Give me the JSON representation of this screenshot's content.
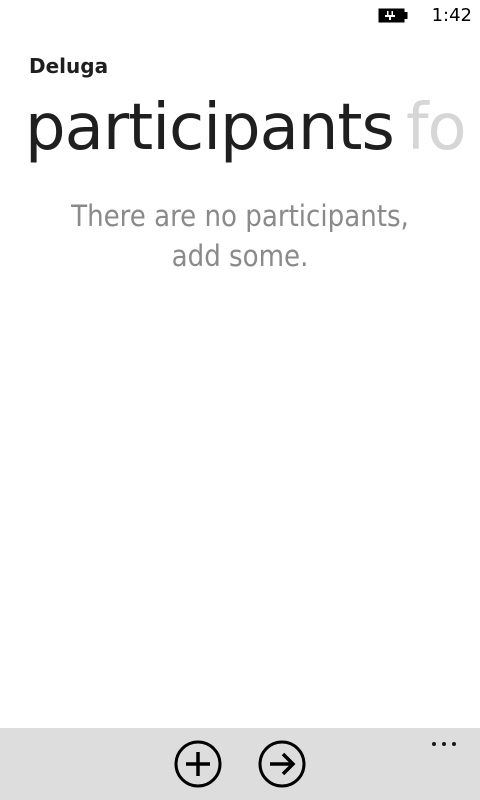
{
  "status_bar": {
    "battery_icon": "battery-charging-icon",
    "time": "1:42"
  },
  "app": {
    "title": "Deluga"
  },
  "pivot": {
    "items": [
      {
        "label": "participants",
        "active": true
      },
      {
        "label": "fo",
        "active": false
      }
    ]
  },
  "content": {
    "empty_message_line1": "There are no participants,",
    "empty_message_line2": "add some."
  },
  "app_bar": {
    "buttons": [
      {
        "icon": "add-circle-icon"
      },
      {
        "icon": "arrow-right-circle-icon"
      }
    ],
    "more_icon": "more-ellipsis-icon"
  },
  "colors": {
    "background": "#ffffff",
    "text": "#1f1f1f",
    "inactive_pivot": "#d6d6d6",
    "message": "#8a8a8a",
    "app_bar": "#dddddd"
  }
}
